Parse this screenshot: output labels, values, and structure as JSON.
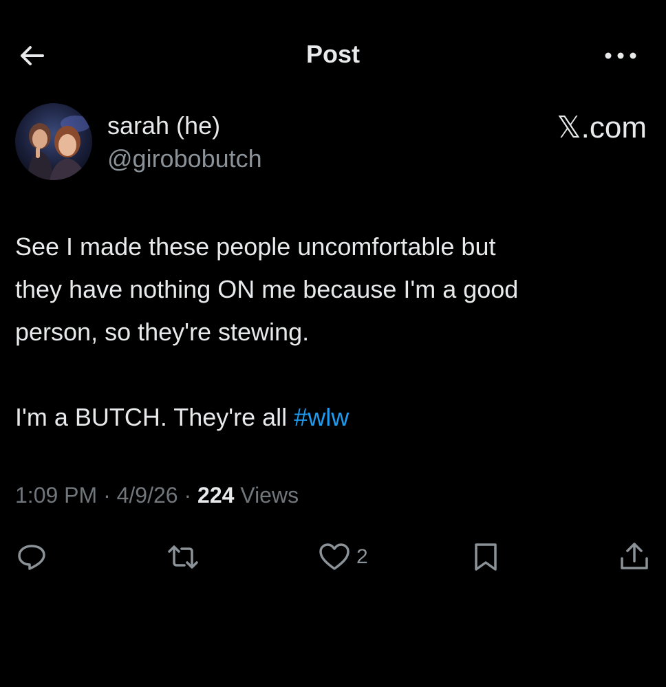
{
  "header": {
    "title": "Post",
    "back_icon": "arrow-left-icon",
    "more_icon": "more-horizontal-icon"
  },
  "author": {
    "display_name": "sarah (he)",
    "handle": "@girobobutch"
  },
  "watermark": "𝕏.com",
  "post": {
    "line1": "See I made these people uncomfortable but",
    "line2": "they have nothing ON me because I'm a good",
    "line3": "person, so they're stewing.",
    "para2_text": "I'm a BUTCH. They're all ",
    "hashtag": "#wlw"
  },
  "meta": {
    "time": "1:09 PM",
    "sep1": " · ",
    "date": "4/9/26",
    "sep2": " · ",
    "views_count": "224",
    "views_label": " Views"
  },
  "actions": {
    "reply_icon": "reply-icon",
    "repost_icon": "repost-icon",
    "like_icon": "heart-icon",
    "like_count": "2",
    "bookmark_icon": "bookmark-icon",
    "share_icon": "share-icon"
  },
  "colors": {
    "background": "#000000",
    "text": "#e7e9ea",
    "secondary": "#71767b",
    "link": "#1d9bf0"
  }
}
